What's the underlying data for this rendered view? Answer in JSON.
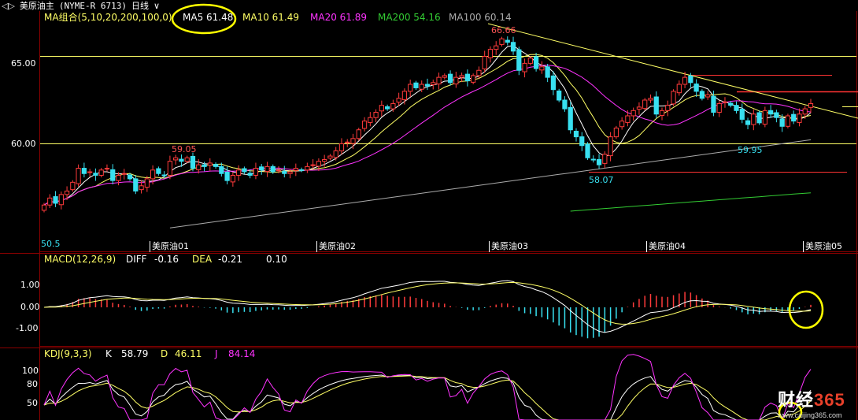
{
  "topbar": {
    "nav_glyph": "◁▷",
    "title": "美原油主",
    "symbol": "(NYME-R 6713)",
    "period": "日线",
    "dropdown_glyph": "∨"
  },
  "legend_main": {
    "label": "MA组合(5,10,20,200,100,0)",
    "items": [
      {
        "text": "MA5 61.48",
        "color": "#ffffff"
      },
      {
        "text": "MA10 61.49",
        "color": "#ffff66"
      },
      {
        "text": "MA20 61.89",
        "color": "#ff33ff"
      },
      {
        "text": "MA200 54.16",
        "color": "#33cc33"
      },
      {
        "text": "MA100 60.14",
        "color": "#aaaaaa"
      }
    ]
  },
  "legend_macd": {
    "label": "MACD(12,26,9)",
    "diff_label": "DIFF",
    "diff_value": "-0.16",
    "dea_label": "DEA",
    "dea_value": "-0.21",
    "macd_value": "0.10"
  },
  "legend_kdj": {
    "label": "KDJ(9,3,3)",
    "k_label": "K",
    "k_value": "58.79",
    "d_label": "D",
    "d_value": "46.11",
    "j_label": "J",
    "j_value": "84.14"
  },
  "watermark": {
    "brand": "财经",
    "digits": "365",
    "url": "www.caijing365.com"
  },
  "colors": {
    "up": "#ff3b3b",
    "down": "#38e0f0",
    "ma5": "#ffffff",
    "ma10": "#ffff66",
    "ma20": "#ff33ff",
    "ma100": "#aaaaaa",
    "ma200": "#33cc33",
    "grid": "#8b0000",
    "hline": "#ffff66",
    "axis_text": "#ffffff"
  },
  "chart_data": [
    {
      "type": "candlestick",
      "title": "美原油主 (NYME-R 6713) 日线",
      "y_ticks": [
        "65.00",
        "60.00"
      ],
      "x_tick_labels": [
        "美原油01",
        "美原油02",
        "美原油03",
        "美原油04",
        "美原油05"
      ],
      "annotations": [
        "66.66",
        "59.05",
        "58.07",
        "59.95",
        "50.5"
      ],
      "ylim": [
        55.8,
        67.6
      ],
      "closes": [
        56.5,
        56.9,
        56.6,
        57.1,
        57.3,
        57.8,
        58.6,
        58.3,
        58.4,
        58.2,
        58.5,
        58.6,
        57.9,
        58.2,
        58.3,
        58.0,
        57.3,
        57.6,
        58.0,
        58.5,
        58.3,
        58.2,
        59.0,
        59.2,
        59.0,
        59.2,
        58.6,
        58.8,
        58.7,
        58.9,
        58.7,
        58.3,
        57.9,
        58.2,
        58.5,
        58.4,
        58.2,
        58.6,
        58.5,
        58.7,
        58.4,
        58.5,
        58.3,
        58.4,
        58.6,
        58.5,
        58.7,
        58.8,
        59.0,
        59.1,
        59.3,
        59.6,
        60.0,
        60.1,
        60.3,
        60.8,
        61.3,
        61.5,
        61.8,
        62.2,
        62.0,
        62.3,
        62.6,
        63.0,
        63.4,
        63.2,
        63.4,
        63.3,
        63.5,
        63.8,
        63.9,
        63.5,
        63.8,
        63.9,
        63.6,
        63.9,
        64.2,
        65.0,
        65.4,
        65.6,
        66.0,
        65.8,
        65.3,
        64.2,
        64.6,
        64.9,
        64.3,
        64.4,
        63.8,
        63.1,
        62.5,
        62.0,
        60.8,
        60.4,
        59.9,
        59.2,
        59.1,
        58.8,
        59.4,
        60.4,
        60.9,
        61.3,
        61.6,
        61.9,
        62.1,
        62.5,
        62.6,
        61.7,
        61.9,
        62.2,
        63.0,
        63.4,
        63.8,
        63.5,
        63.0,
        62.6,
        62.8,
        61.8,
        62.3,
        62.4,
        62.2,
        61.9,
        61.4,
        61.1,
        61.7,
        61.2,
        61.9,
        61.7,
        61.5,
        61.0,
        61.6,
        61.3,
        61.7,
        62.0,
        62.3
      ],
      "macd_hist_labels": [
        "1.00",
        "0.00",
        "-1.00"
      ],
      "kdj_labels": [
        "100",
        "80",
        "50"
      ]
    }
  ]
}
